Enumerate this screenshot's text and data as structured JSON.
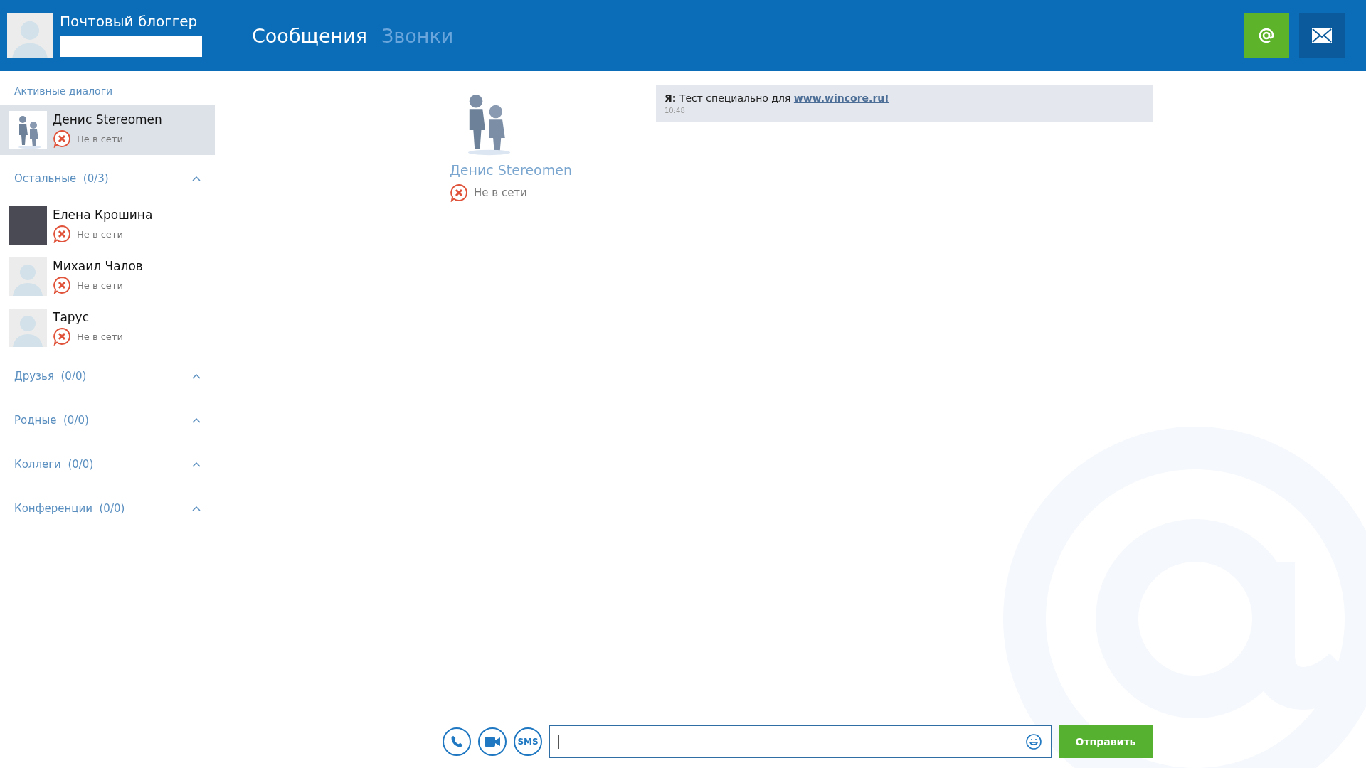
{
  "header": {
    "user_name": "Почтовый блоггер",
    "tabs": [
      {
        "label": "Сообщения",
        "selected": true
      },
      {
        "label": "Звонки",
        "selected": false
      }
    ]
  },
  "sidebar": {
    "active_title": "Активные диалоги",
    "active": [
      {
        "name": "Денис Stereomen",
        "status": "Не в сети",
        "online": false,
        "kind": "figures",
        "selected": true
      }
    ],
    "groups": [
      {
        "title": "Остальные",
        "count": "(0/3)",
        "expanded": true,
        "contacts": [
          {
            "name": "Елена Крошина",
            "status": "Не в сети",
            "online": false,
            "kind": "photo",
            "selected": false
          },
          {
            "name": "Михаил Чалов",
            "status": "Не в сети",
            "online": false,
            "kind": "none",
            "selected": false
          },
          {
            "name": "Тарус",
            "status": "Не в сети",
            "online": false,
            "kind": "none",
            "selected": false
          }
        ]
      },
      {
        "title": "Друзья",
        "count": "(0/0)",
        "expanded": true
      },
      {
        "title": "Родные",
        "count": "(0/0)",
        "expanded": true
      },
      {
        "title": "Коллеги",
        "count": "(0/0)",
        "expanded": true
      },
      {
        "title": "Конференции",
        "count": "(0/0)",
        "expanded": true
      }
    ]
  },
  "chat": {
    "contact": {
      "name": "Денис Stereomen",
      "status": "Не в сети",
      "online": false,
      "kind": "figures"
    },
    "messages": [
      {
        "sender": "Я:",
        "text": "Тест специально для ",
        "link": "www.wincore.ru!",
        "time": "10:48"
      }
    ]
  },
  "composer": {
    "sms_label": "SMS",
    "send": "Отправить"
  }
}
